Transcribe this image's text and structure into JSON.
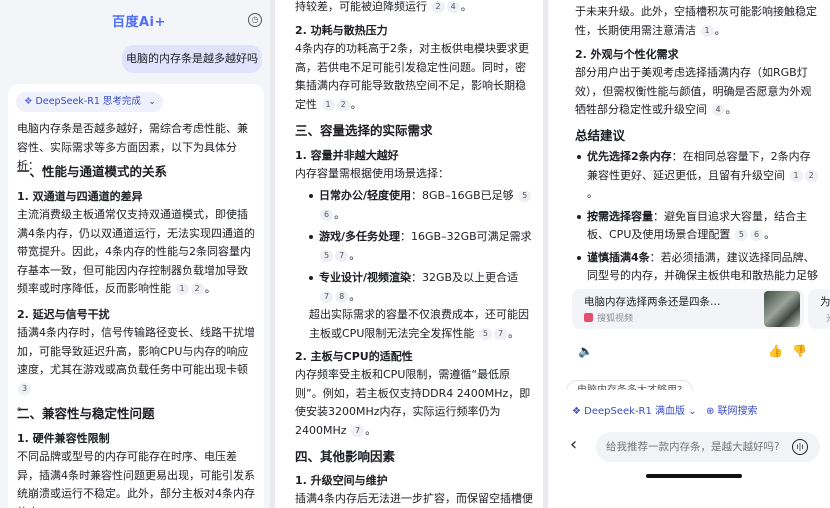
{
  "panel1": {
    "logo": "百度Ai+",
    "user_question": "电脑的内存条是越多越好吗",
    "model_badge": "DeepSeek-R1 思考完成",
    "intro": "电脑内存条是否越多越好，需综合考虑性能、兼容性、实际需求等多方面因素，以下为具体分析：",
    "sec1_title": "一、性能与通道模式的关系",
    "sec1_sub1": "1. 双通道与四通道的差异",
    "sec1_p1": "主流消费级主板通常仅支持双通道模式，即使插满4条内存，仍以双通道运行，无法实现四通道的带宽提升。因此，4条内存的性能与2条同容量内存基本一致，但可能因内存控制器负载增加导致频率或时序降低，反而影响性能",
    "sec1_p1_cites": [
      "1",
      "2"
    ],
    "sec1_sub2": "2. 延迟与信号干扰",
    "sec1_p2": "插满4条内存时，信号传输路径变长、线路干扰增加，可能导致延迟升高，影响CPU与内存的响应速度，尤其在游戏或高负载任务中可能出现卡顿",
    "sec1_p2_cites": [
      "3"
    ],
    "sec2_title": "二、兼容性与稳定性问题",
    "sec2_sub1": "1. 硬件兼容性限制",
    "sec2_p1": "不同品牌或型号的内存可能存在时序、电压差异，插满4条时兼容性问题更易出现，可能引发系统崩溃或运行不稳定。此外，部分主板对4条内存的支"
  },
  "panel2": {
    "top_line": "持较差，可能被迫降频运行",
    "top_cites": [
      "2",
      "4"
    ],
    "sub2": "2. 功耗与散热压力",
    "p2": "4条内存的功耗高于2条，对主板供电模块要求更高，若供电不足可能引发稳定性问题。同时，密集插满内存可能导致散热空间不足，影响长期稳定性",
    "p2_cites": [
      "1",
      "2"
    ],
    "sec3_title": "三、容量选择的实际需求",
    "sec3_sub1": "1. 容量并非越大越好",
    "sec3_p1": "内存容量需根据使用场景选择：",
    "bullets": [
      {
        "label": "日常办公/轻度使用",
        "text": "：8GB–16GB已足够",
        "cites": [
          "5",
          "6"
        ]
      },
      {
        "label": "游戏/多任务处理",
        "text": "：16GB–32GB可满足需求",
        "cites": [
          "5",
          "7"
        ]
      },
      {
        "label": "专业设计/视频渲染",
        "text": "：32GB及以上更合适",
        "cites": [
          "7",
          "8"
        ]
      }
    ],
    "sec3_note": "超出实际需求的容量不仅浪费成本，还可能因主板或CPU限制无法完全发挥性能",
    "sec3_note_cites": [
      "5",
      "7"
    ],
    "sec3_sub2": "2. 主板与CPU的适配性",
    "sec3_p2": "内存频率受主板和CPU限制，需遵循“最低原则”。例如，若主板仅支持DDR4 2400MHz，即使安装3200MHz内存，实际运行频率仍为2400MHz",
    "sec3_p2_cites": [
      "7"
    ],
    "sec4_title": "四、其他影响因素",
    "sec4_sub1": "1. 升级空间与维护",
    "sec4_p1": "插满4条内存后无法进一步扩容，而保留空插槽便"
  },
  "panel3": {
    "p_top": "于未来升级。此外，空插槽积灰可能影响接触稳定性，长期使用需注意清洁",
    "p_top_cites": [
      "1"
    ],
    "sub2": "2. 外观与个性化需求",
    "p2": "部分用户出于美观考虑选择插满内存（如RGB灯效），但需权衡性能与颜值，明确是否愿意为外观牺牲部分稳定性或升级空间",
    "p2_cites": [
      "4"
    ],
    "summary_title": "总结建议",
    "summary": [
      {
        "label": "优先选择2条内存",
        "text": "：在相同总容量下，2条内存兼容性更好、延迟更低，且留有升级空间",
        "cites": [
          "1",
          "2"
        ]
      },
      {
        "label": "按需选择容量",
        "text": "：避免盲目追求大容量，结合主板、CPU及使用场景合理配置",
        "cites": [
          "5",
          "6"
        ]
      },
      {
        "label": "谨慎插满4条",
        "text": "：若必须插满，建议选择同品牌、同型号的内存，并确保主板供电和散热能力足够",
        "cites": [
          "2",
          "3"
        ]
      }
    ],
    "video1_title": "电脑内存选择两条还是四条…",
    "video1_source": "搜狐视频",
    "video2_title": "为什么",
    "video2_source": "光森",
    "suggest_text": "电脑内存条多大才够用?",
    "chip_model": "DeepSeek-R1 满血版",
    "chip_web": "联网搜索",
    "input_placeholder": "给我推荐一款内存条，是越大越好吗?"
  }
}
